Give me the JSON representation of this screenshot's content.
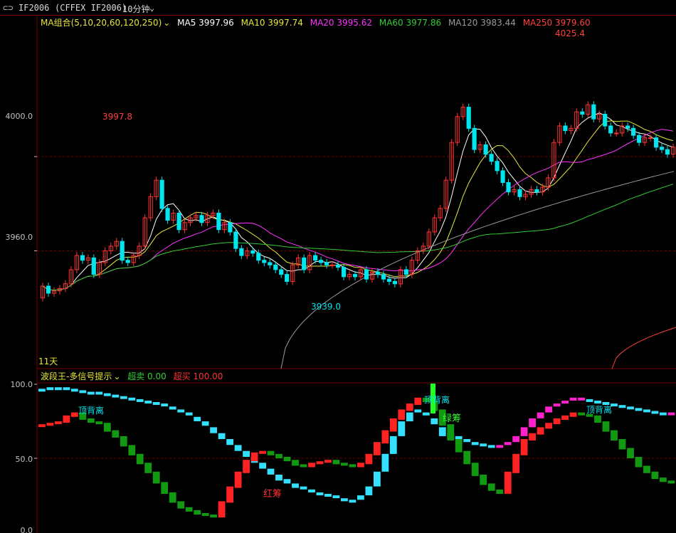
{
  "header": {
    "symbol": "IF2006",
    "contract": "(CFFEX IF2006)",
    "period": "10分钟"
  },
  "ma_legend": {
    "group_label": "MA组合(5,10,20,60,120,250)",
    "items": [
      {
        "label": "MA5 3997.96",
        "color": "#ffffff"
      },
      {
        "label": "MA10 3997.74",
        "color": "#e6e63c"
      },
      {
        "label": "MA20 3995.62",
        "color": "#ff33ff"
      },
      {
        "label": "MA60 3977.86",
        "color": "#33cc33"
      },
      {
        "label": "MA120 3983.44",
        "color": "#9a9a9a"
      },
      {
        "label": "MA250 3979.60",
        "color": "#ff4040"
      }
    ]
  },
  "indicator_legend": {
    "name": "波段王-多信号提示",
    "items": [
      {
        "label": "超卖 0.00",
        "color": "#33cc33"
      },
      {
        "label": "超买 100.00",
        "color": "#ff3333"
      }
    ]
  },
  "price_axis": {
    "ticks": [
      "4000.0",
      "3960.0"
    ]
  },
  "indicator_axis": {
    "ticks": [
      "100.0",
      "50.0",
      "0.0"
    ]
  },
  "annotations": {
    "high_left": "3997.8",
    "high_right": "4025.4",
    "low": "3939.0",
    "days": "11天"
  },
  "indicator_annotations": {
    "top_div_1": "顶背离",
    "top_div_2": "顶背离",
    "top_div_3": "顶背离",
    "red_chip": "红筹",
    "green_chip": "绿筹"
  },
  "colors": {
    "up": "#ff3333",
    "down": "#00e5ee",
    "grid": "#7a0000",
    "axis_text": "#c0c0c0"
  },
  "chart_data": [
    {
      "type": "candlestick",
      "title": "IF2006 10分钟",
      "ylim": [
        3910,
        4055
      ],
      "ticks": [
        3960,
        4000
      ],
      "close": [
        3945,
        3942,
        3943,
        3944,
        3946,
        3952,
        3958,
        3956,
        3957,
        3950,
        3955,
        3960,
        3962,
        3964,
        3956,
        3955,
        3958,
        3962,
        3974,
        3983,
        3990,
        3978,
        3973,
        3976,
        3969,
        3972,
        3974,
        3975,
        3972,
        3975,
        3976,
        3969,
        3972,
        3968,
        3961,
        3958,
        3960,
        3959,
        3956,
        3955,
        3954,
        3952,
        3950,
        3947,
        3954,
        3957,
        3952,
        3958,
        3956,
        3955,
        3954,
        3954,
        3953,
        3949,
        3950,
        3949,
        3952,
        3948,
        3951,
        3950,
        3948,
        3947,
        3946,
        3952,
        3950,
        3956,
        3960,
        3962,
        3968,
        3974,
        3978,
        3990,
        4006,
        4017,
        4021,
        4012,
        4003,
        4005,
        4001,
        3998,
        3994,
        3989,
        3985,
        3986,
        3983,
        3984,
        3986,
        3985,
        3987,
        3991,
        4006,
        4013,
        4011,
        4012,
        4019,
        4018,
        4022,
        4016,
        4018,
        4013,
        4010,
        4010,
        4013,
        4012,
        4009,
        4006,
        4008,
        4008,
        4004,
        4003,
        4001,
        4004
      ],
      "open": [
        3940,
        3945,
        3942,
        3943,
        3944,
        3946,
        3952,
        3958,
        3956,
        3957,
        3950,
        3955,
        3960,
        3962,
        3964,
        3956,
        3955,
        3958,
        3962,
        3974,
        3983,
        3990,
        3978,
        3973,
        3976,
        3969,
        3972,
        3974,
        3975,
        3972,
        3975,
        3976,
        3969,
        3972,
        3968,
        3961,
        3958,
        3960,
        3959,
        3956,
        3955,
        3954,
        3952,
        3950,
        3947,
        3954,
        3957,
        3952,
        3958,
        3956,
        3955,
        3954,
        3954,
        3953,
        3949,
        3950,
        3949,
        3952,
        3948,
        3951,
        3950,
        3948,
        3947,
        3946,
        3952,
        3950,
        3956,
        3960,
        3962,
        3968,
        3974,
        3978,
        3990,
        4006,
        4017,
        4021,
        4012,
        4003,
        4005,
        4001,
        3998,
        3994,
        3989,
        3985,
        3986,
        3983,
        3984,
        3986,
        3985,
        3987,
        3991,
        4006,
        4013,
        4011,
        4012,
        4019,
        4018,
        4022,
        4016,
        4018,
        4013,
        4010,
        4010,
        4013,
        4012,
        4009,
        4006,
        4008,
        4008,
        4004,
        4003,
        4001
      ]
    },
    {
      "type": "line",
      "title": "波段王-多信号提示",
      "ylim": [
        0,
        100
      ],
      "series": [
        {
          "name": "red",
          "values": [
            72,
            73,
            74,
            78,
            80,
            76,
            74,
            73,
            68,
            64,
            58,
            52,
            46,
            40,
            33,
            26,
            20,
            16,
            14,
            12,
            11,
            10,
            20,
            30,
            40,
            48,
            53,
            54,
            52,
            50,
            48,
            45,
            44,
            46,
            47,
            48,
            46,
            45,
            44,
            46,
            52,
            60,
            68,
            76,
            82,
            86,
            90,
            88,
            82,
            72,
            62,
            54,
            46,
            38,
            32,
            28,
            26,
            40,
            52,
            62,
            66,
            70,
            73,
            76,
            78,
            80,
            79,
            78,
            74,
            68,
            62,
            56,
            50,
            44,
            40,
            36,
            34,
            33
          ]
        },
        {
          "name": "cyan",
          "values": [
            96,
            97,
            97,
            97,
            96,
            95,
            94,
            94,
            93,
            92,
            91,
            90,
            89,
            88,
            87,
            86,
            84,
            82,
            80,
            77,
            74,
            70,
            66,
            62,
            58,
            54,
            50,
            46,
            42,
            38,
            35,
            32,
            30,
            28,
            26,
            25,
            24,
            22,
            21,
            24,
            30,
            40,
            52,
            64,
            74,
            80,
            82,
            80,
            76,
            70,
            66,
            64,
            62,
            60,
            59,
            58,
            58,
            60,
            64,
            70,
            76,
            80,
            84,
            86,
            88,
            90,
            90,
            89,
            88,
            87,
            86,
            85,
            84,
            83,
            82,
            81,
            80,
            80
          ]
        }
      ]
    }
  ]
}
